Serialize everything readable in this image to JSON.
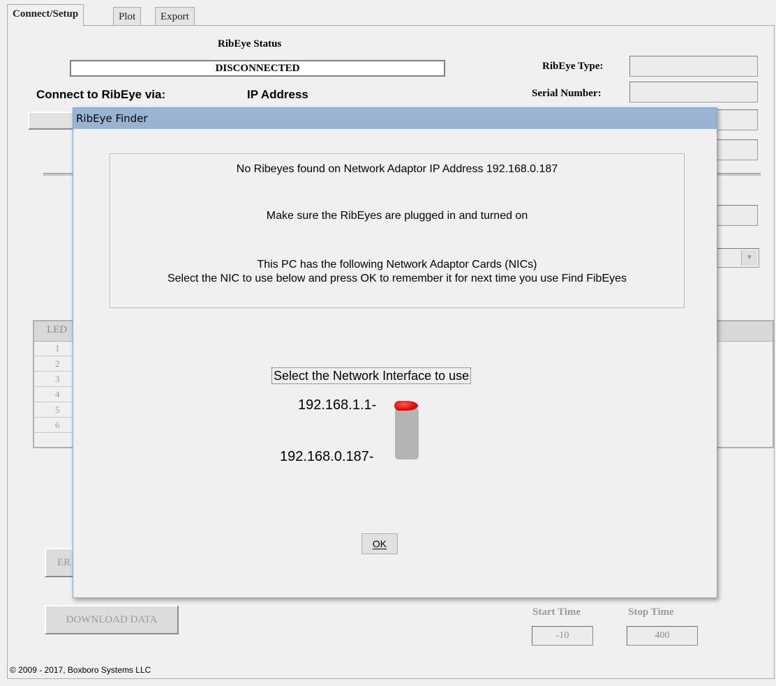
{
  "tabs": [
    {
      "label": "Connect/Setup",
      "active": true
    },
    {
      "label": "Plot",
      "active": false
    },
    {
      "label": "Export",
      "active": false
    }
  ],
  "status": {
    "heading": "RibEye Status",
    "value": "DISCONNECTED"
  },
  "connect": {
    "label": "Connect to RibEye via:",
    "method": "IP Address"
  },
  "device_info": {
    "type_label": "RibEye Type:",
    "type_value": "",
    "serial_label": "Serial Number:",
    "serial_value": ""
  },
  "led_table": {
    "header": "LED",
    "rows": [
      "1",
      "2",
      "3",
      "4",
      "5",
      "6"
    ]
  },
  "buttons": {
    "erase_partial": "ER",
    "download": "DOWNLOAD DATA"
  },
  "time_window": {
    "start_label": "Start Time",
    "start_value": "-10",
    "stop_label": "Stop Time",
    "stop_value": "400"
  },
  "footer": {
    "copyright": "© 2009 - 2017, Boxboro Systems LLC"
  },
  "dialog": {
    "title": "RibEye Finder",
    "messages": {
      "line1": "No Ribeyes found on Network Adaptor IP Address 192.168.0.187",
      "line2": "Make sure the RibEyes are plugged in and turned on",
      "line3": "This PC has the following Network Adaptor Cards (NICs)",
      "line4": "Select the NIC to use below and press OK to remember it for next time you use Find FibEyes"
    },
    "nic_selector": {
      "label": "Select the Network Interface to use",
      "options": [
        "192.168.1.1",
        "192.168.0.187"
      ],
      "selected": "192.168.1.1"
    },
    "ok_button": "OK"
  },
  "colors": {
    "titlebar": "#99b4d1",
    "window_bg": "#f0f0f0",
    "switch_knob": "#e01010",
    "switch_track": "#b4b4b4"
  }
}
